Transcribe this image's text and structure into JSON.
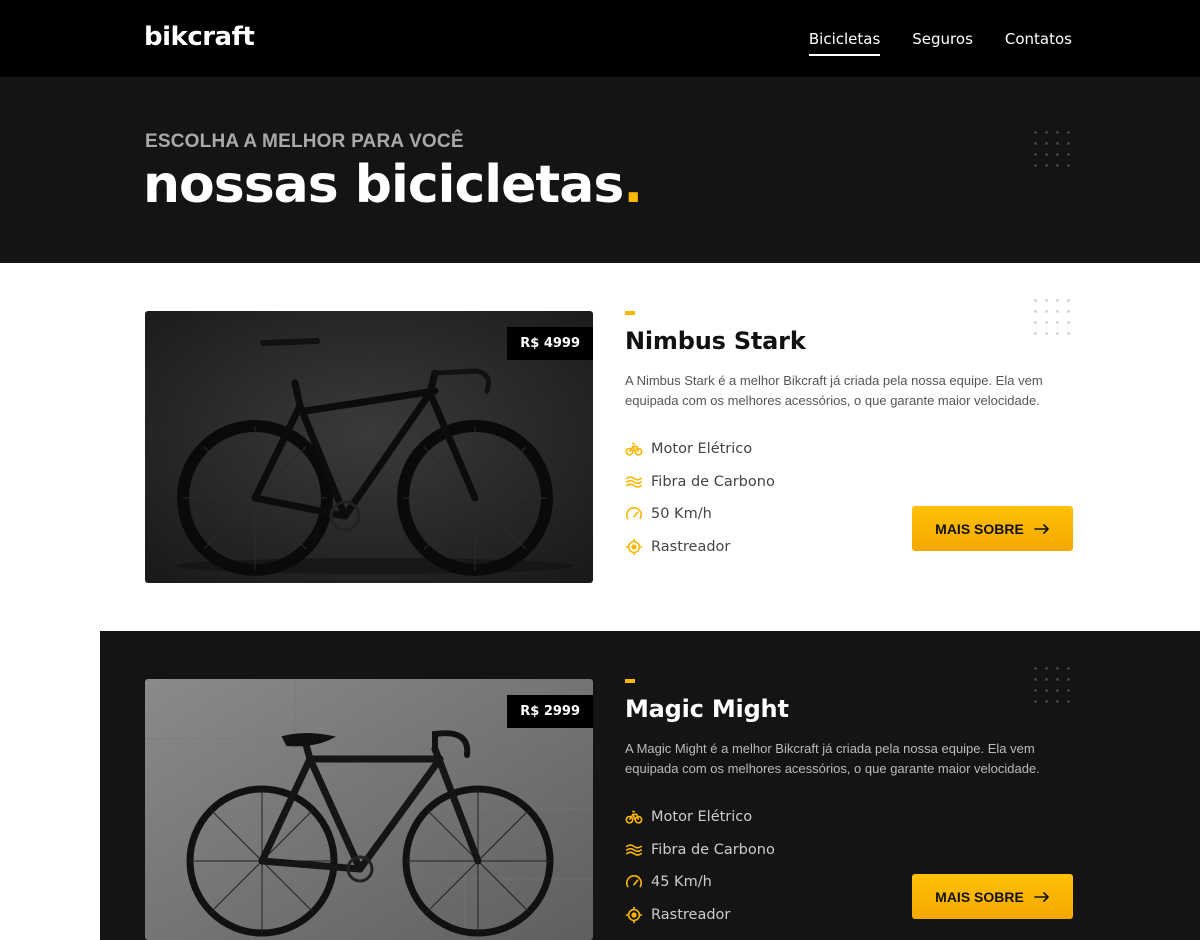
{
  "header": {
    "logo": "bikcraft",
    "nav": [
      "Bicicletas",
      "Seguros",
      "Contatos"
    ]
  },
  "hero": {
    "subtitle": "ESCOLHA A MELHOR PARA VOCÊ",
    "title": "nossas bicicletas",
    "title_dot": "."
  },
  "colors": {
    "accent": "#fbb700",
    "dark": "#141414"
  },
  "bikes": [
    {
      "price": "R$ 4999",
      "name": "Nimbus Stark",
      "description": "A Nimbus Stark é a melhor Bikcraft já criada pela nossa equipe. Ela vem equipada com os melhores acessórios, o que garante maior velocidade.",
      "features": [
        "Motor Elétrico",
        "Fibra de Carbono",
        "50 Km/h",
        "Rastreador"
      ],
      "button": "MAIS SOBRE"
    },
    {
      "price": "R$ 2999",
      "name": "Magic Might",
      "description": "A Magic Might é a melhor Bikcraft já criada pela nossa equipe. Ela vem equipada com os melhores acessórios, o que garante maior velocidade.",
      "features": [
        "Motor Elétrico",
        "Fibra de Carbono",
        "45 Km/h",
        "Rastreador"
      ],
      "button": "MAIS SOBRE"
    }
  ],
  "icons": [
    "bike-motor-icon",
    "carbon-fiber-icon",
    "speedometer-icon",
    "tracker-icon",
    "arrow-right-icon"
  ]
}
